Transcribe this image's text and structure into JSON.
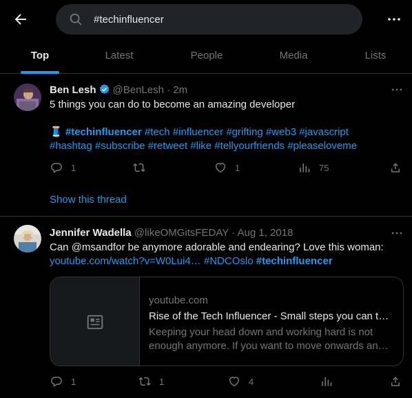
{
  "search": {
    "query": "#techinfluencer"
  },
  "tabs": [
    {
      "label": "Top"
    },
    {
      "label": "Latest"
    },
    {
      "label": "People"
    },
    {
      "label": "Media"
    },
    {
      "label": "Lists"
    }
  ],
  "tweets": [
    {
      "name": "Ben Lesh",
      "handle": "@BenLesh",
      "time": "· 2m",
      "text": "5 things you can do to become an amazing developer",
      "emoji": "🧵",
      "tags_line1_bold": "#techinfluencer",
      "tags_line1_rest": " #tech #influencer #grifting #web3 #javascript",
      "tags_line2": "#hashtag #subscribe #retweet #like #tellyourfriends #pleaseloveme",
      "replies": "1",
      "retweets": "",
      "likes": "1",
      "views": "75",
      "thread_link": "Show this thread"
    },
    {
      "name": "Jennifer Wadella",
      "handle": "@likeOMGitsFEDAY",
      "time": "· Aug 1, 2018",
      "text": "Can @msandfor be anymore adorable and endearing? Love this woman:",
      "link_url": "youtube.com/watch?v=W0Lui4…",
      "link_tag1": "#NDCOslo",
      "link_tag2": "#techinfluencer",
      "card_domain": "youtube.com",
      "card_title": "Rise of the Tech Influencer - Small steps you can t…",
      "card_desc": "Keeping your head down and working hard is not enough anymore. If you want to move onwards an…",
      "replies": "1",
      "retweets": "1",
      "likes": "4",
      "views": ""
    }
  ],
  "colors": {
    "accent": "#1d9bf0",
    "muted": "#71767b",
    "text": "#e7e9ea",
    "border": "#2f3336",
    "background": "#000000"
  },
  "icons": [
    "back-arrow-icon",
    "search-icon",
    "more-icon",
    "verified-badge-icon",
    "reply-icon",
    "retweet-icon",
    "like-icon",
    "views-icon",
    "share-icon",
    "article-icon"
  ]
}
